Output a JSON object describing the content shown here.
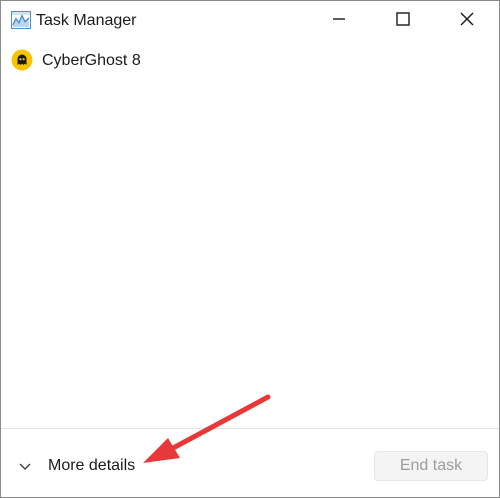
{
  "window": {
    "title": "Task Manager",
    "icon": "task-manager-icon"
  },
  "title_controls": {
    "minimize": "minimize-icon",
    "maximize": "maximize-icon",
    "close": "close-icon"
  },
  "apps": [
    {
      "name": "CyberGhost 8",
      "icon": "cyberghost-icon"
    }
  ],
  "footer": {
    "more_details_label": "More details",
    "end_task_label": "End task",
    "end_task_enabled": false
  },
  "annotation": {
    "color": "#e8393a",
    "points_to": "More details"
  },
  "colors": {
    "accent_annotation": "#e8393a",
    "cyberghost_yellow": "#f6c500",
    "disabled_text": "#9d9d9d"
  }
}
